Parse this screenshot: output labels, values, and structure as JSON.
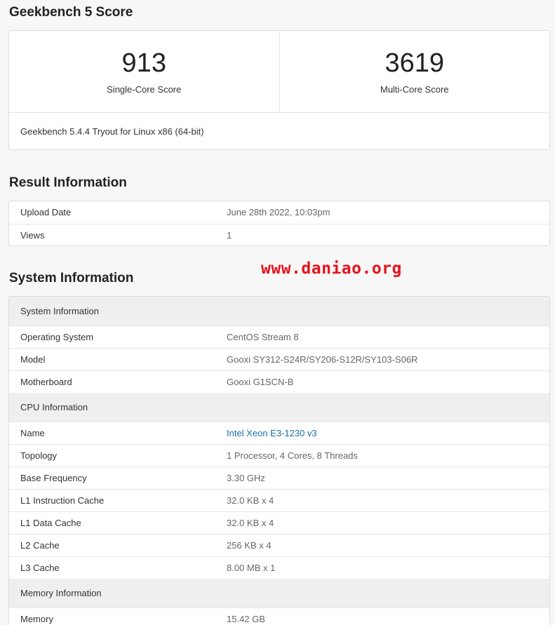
{
  "score_section": {
    "title": "Geekbench 5 Score",
    "single_core": {
      "value": "913",
      "label": "Single-Core Score"
    },
    "multi_core": {
      "value": "3619",
      "label": "Multi-Core Score"
    },
    "version": "Geekbench 5.4.4 Tryout for Linux x86 (64-bit)"
  },
  "result_section": {
    "title": "Result Information",
    "rows": [
      {
        "key": "Upload Date",
        "value": "June 28th 2022, 10:03pm"
      },
      {
        "key": "Views",
        "value": "1"
      }
    ]
  },
  "system_section": {
    "title": "System Information",
    "groups": [
      {
        "header": "System Information",
        "rows": [
          {
            "key": "Operating System",
            "value": "CentOS Stream 8"
          },
          {
            "key": "Model",
            "value": "Gooxi SY312-S24R/SY206-S12R/SY103-S06R"
          },
          {
            "key": "Motherboard",
            "value": "Gooxi G1SCN-B"
          }
        ]
      },
      {
        "header": "CPU Information",
        "rows": [
          {
            "key": "Name",
            "value": "Intel Xeon E3-1230 v3"
          },
          {
            "key": "Topology",
            "value": "1 Processor, 4 Cores, 8 Threads"
          },
          {
            "key": "Base Frequency",
            "value": "3.30 GHz"
          },
          {
            "key": "L1 Instruction Cache",
            "value": "32.0 KB x 4"
          },
          {
            "key": "L1 Data Cache",
            "value": "32.0 KB x 4"
          },
          {
            "key": "L2 Cache",
            "value": "256 KB x 4"
          },
          {
            "key": "L3 Cache",
            "value": "8.00 MB x 1"
          }
        ]
      },
      {
        "header": "Memory Information",
        "rows": [
          {
            "key": "Memory",
            "value": "15.42 GB"
          }
        ]
      }
    ]
  },
  "watermark": "www.daniao.org",
  "colors": {
    "link": "#1a6fa8",
    "watermark": "#e8121c",
    "section_bg": "#efefef"
  }
}
